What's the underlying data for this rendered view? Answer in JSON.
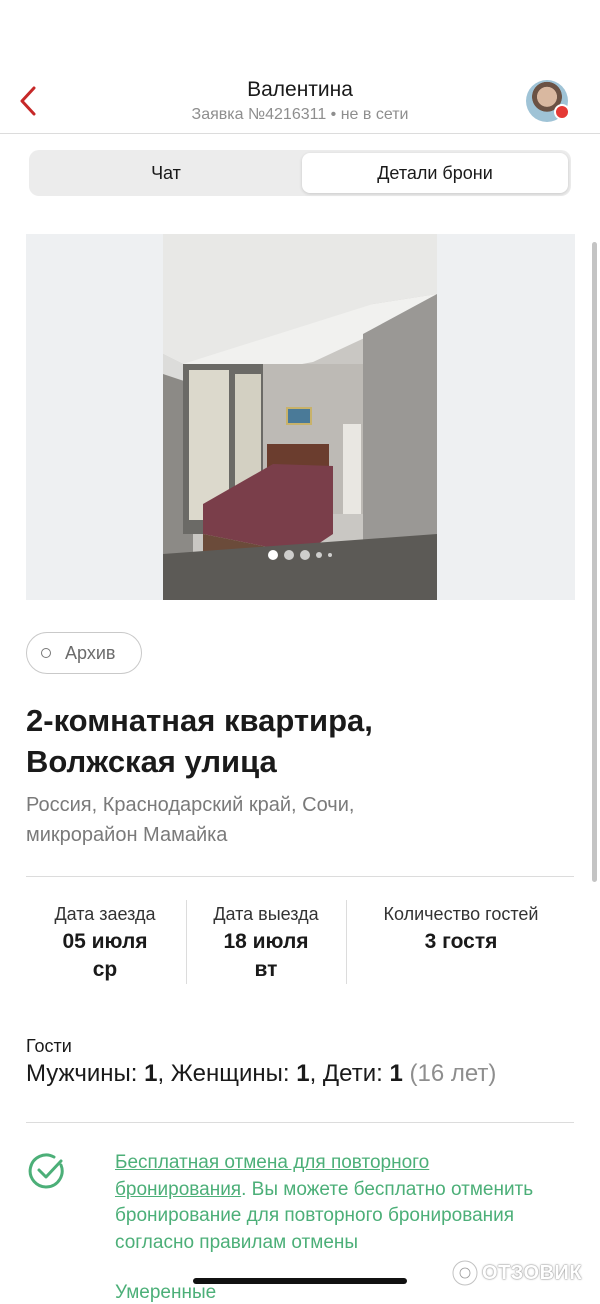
{
  "header": {
    "name": "Валентина",
    "subtitle": "Заявка №4216311 • не в сети"
  },
  "tabs": [
    {
      "label": "Чат",
      "active": false
    },
    {
      "label": "Детали брони",
      "active": true
    }
  ],
  "gallery": {
    "current": 1,
    "visible_dots": 5
  },
  "badge": {
    "label": "Архив"
  },
  "listing": {
    "title_line1": "2-комнатная квартира,",
    "title_line2": "Волжская улица",
    "address_line1": "Россия, Краснодарский край, Сочи,",
    "address_line2": "микрорайон Мамайка"
  },
  "stats": [
    {
      "label": "Дата заезда",
      "value_line1": "05 июля",
      "value_line2": "ср"
    },
    {
      "label": "Дата выезда",
      "value_line1": "18 июля",
      "value_line2": "вт"
    },
    {
      "label": "Количество гостей",
      "value_line1": "3 гостя",
      "value_line2": ""
    }
  ],
  "guests": {
    "label": "Гости",
    "men_label": "Мужчины: ",
    "men_count": "1",
    "women_label": ", Женщины: ",
    "women_count": "1",
    "kids_label": ", Дети: ",
    "kids_count": "1",
    "kids_age": " (16 лет)"
  },
  "policy": {
    "link_text_line1": "Бесплатная отмена для повторного",
    "link_text_line2": "бронирования",
    "text": ". Вы можете бесплатно отменить бронирование для повторного бронирования согласно правилам отмены",
    "next_item": "Умеренные"
  },
  "watermark": {
    "text": "ОТЗОВИК"
  },
  "colors": {
    "accent_red": "#c62828",
    "green": "#4caf78",
    "status_offline": "#e53935"
  }
}
